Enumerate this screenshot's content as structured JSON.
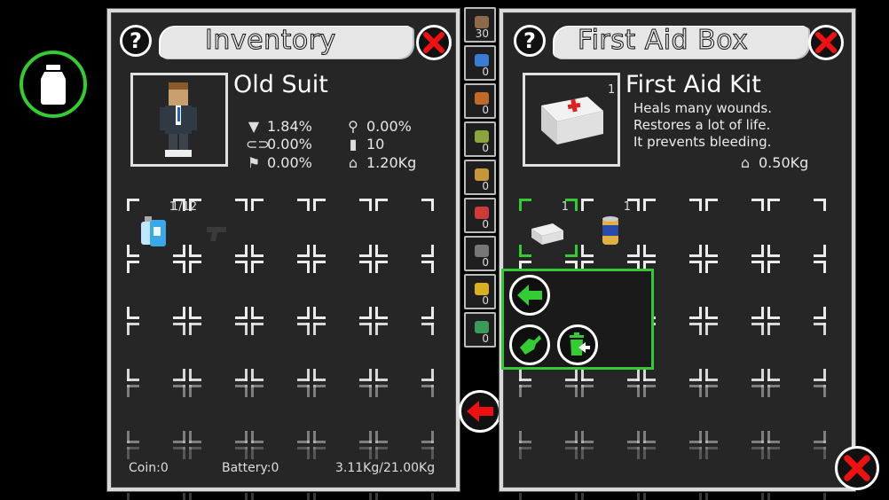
{
  "inventory": {
    "title": "Inventory",
    "help_label": "?",
    "item_name": "Old Suit",
    "stats": {
      "armor": "1.84%",
      "goggles": "0.00%",
      "run": "0.00%",
      "ammo": "0.00%",
      "capacity": "10",
      "weight": "1.20Kg"
    },
    "slots": [
      {
        "item": "water-bottles",
        "qty": "1"
      },
      {
        "item": "pistol",
        "qty": "1/12"
      }
    ],
    "footer": {
      "coin": "Coin:0",
      "battery": "Battery:0",
      "weight": "3.11Kg/21.00Kg"
    }
  },
  "container": {
    "title": "First Aid Box",
    "help_label": "?",
    "item_name": "First Aid Kit",
    "item_qty": "1",
    "description": [
      "Heals many wounds.",
      "Restores a lot of life.",
      "It prevents bleeding."
    ],
    "weight": "0.50Kg",
    "slots": [
      {
        "item": "first-aid-kit",
        "qty": "1"
      },
      {
        "item": "canned-food",
        "qty": "1"
      }
    ]
  },
  "quickbar": {
    "counts": [
      "30",
      "0",
      "0",
      "0",
      "0",
      "0",
      "0",
      "0",
      "0"
    ]
  },
  "colors": {
    "accent_green": "#37c837",
    "close_red": "#e11",
    "panel_bg": "#262626"
  },
  "icons": {
    "bottle": "bottle-icon",
    "close": "close-icon",
    "move": "move-arrow-icon",
    "equip": "hand-pickup-icon",
    "discard": "trash-icon"
  }
}
